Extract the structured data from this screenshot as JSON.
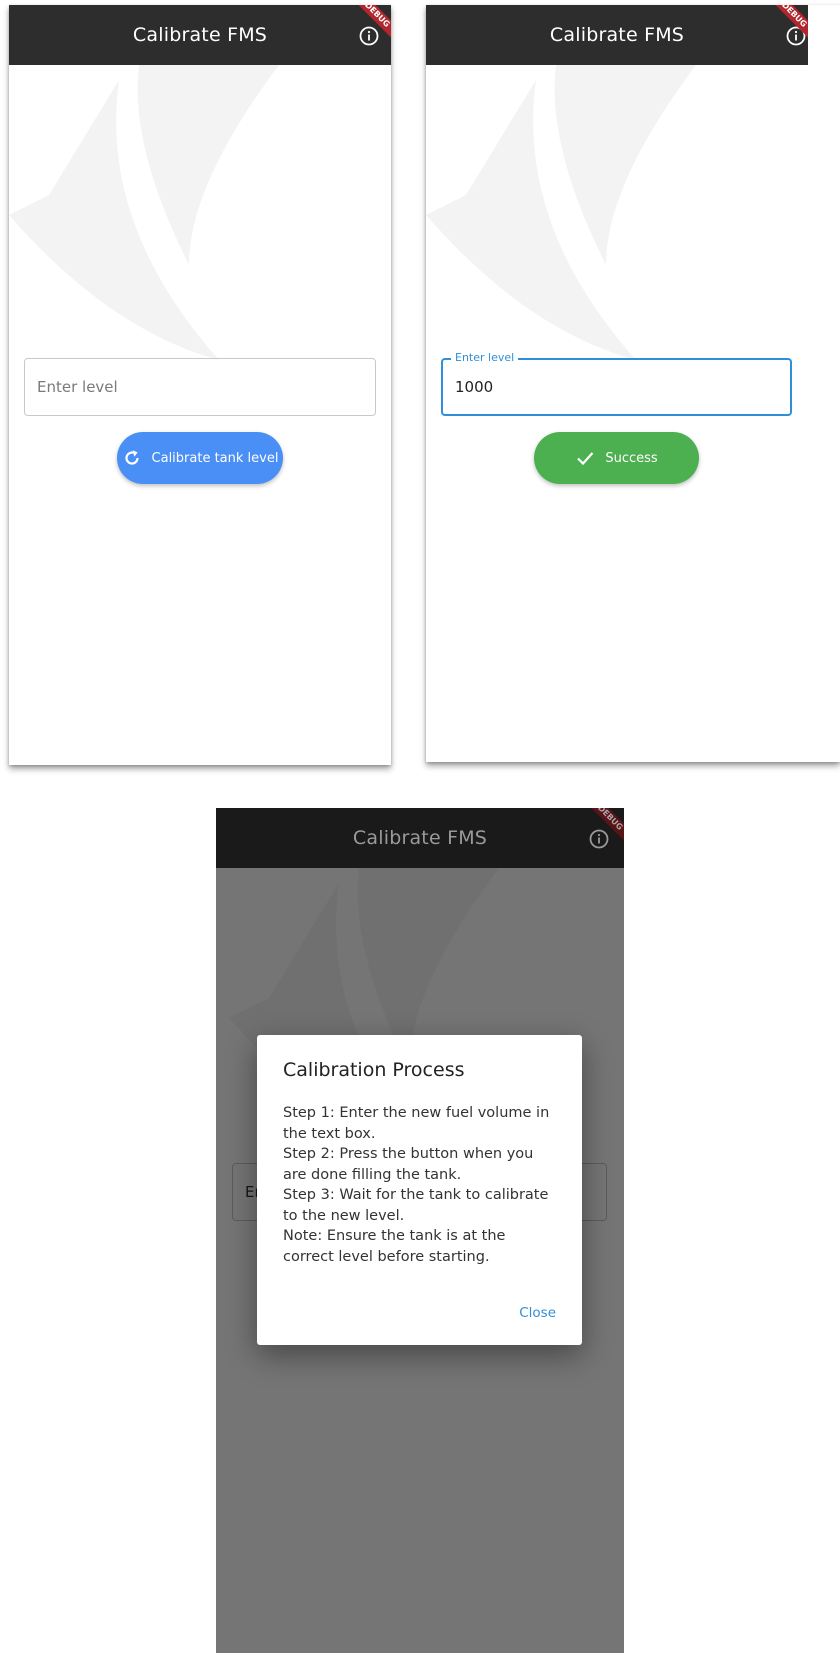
{
  "app": {
    "title": "Calibrate FMS",
    "debug_banner": "DEBUG",
    "info_icon": "info-circle-icon"
  },
  "screen1": {
    "input": {
      "value": "",
      "placeholder": "Enter level"
    },
    "button": {
      "label": "Calibrate tank level",
      "icon": "refresh-icon",
      "color": "#4a8ff5"
    }
  },
  "screen2": {
    "input": {
      "label": "Enter level",
      "value": "1000"
    },
    "button": {
      "label": "Success",
      "icon": "check-icon",
      "color": "#4caf50"
    }
  },
  "screen3": {
    "input_partial_text": "Er",
    "dialog": {
      "title": "Calibration Process",
      "lines": [
        "Step 1: Enter the new fuel volume in",
        "the text box.",
        "Step 2: Press the button when you",
        "are done filling the tank.",
        "Step 3: Wait for the tank to calibrate",
        "to the new level.",
        "Note: Ensure the tank is at the",
        "correct level before starting."
      ],
      "close_label": "Close"
    }
  },
  "colors": {
    "appbar": "#2d2d2d",
    "accent": "#2f8fd8",
    "debug_ribbon": "#b3262d"
  }
}
